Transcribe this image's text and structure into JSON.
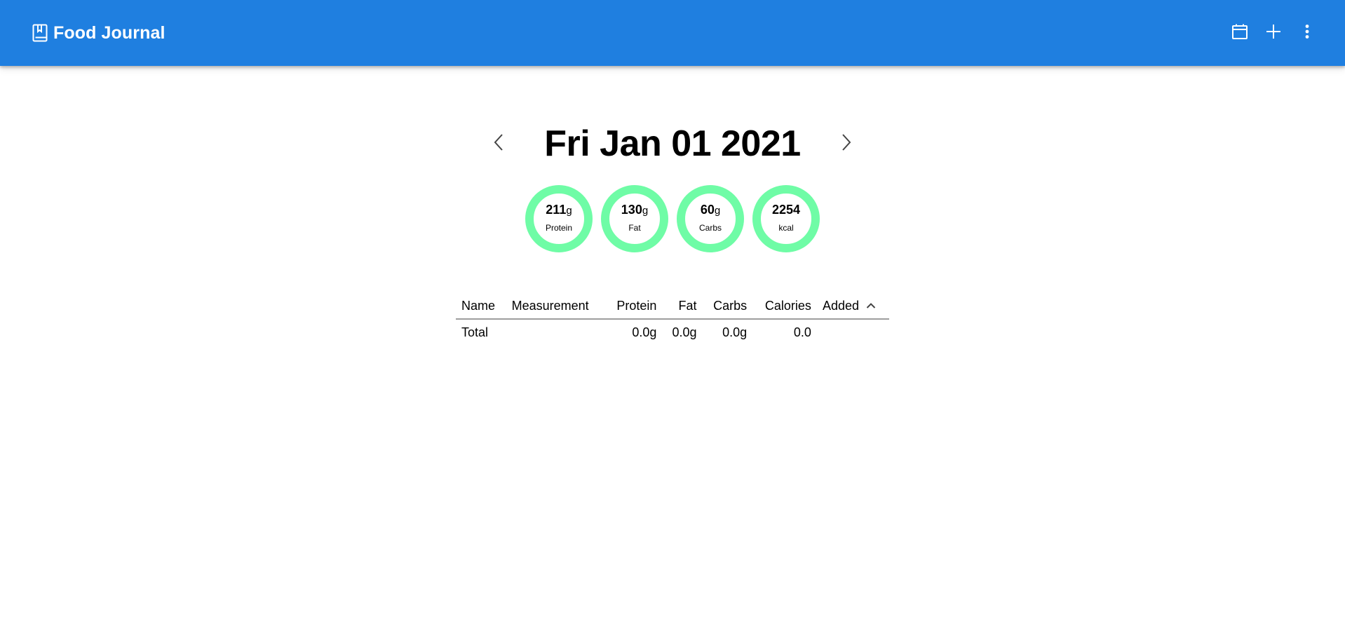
{
  "app": {
    "title": "Food Journal",
    "brand_icon": "book-bookmark-icon"
  },
  "toolbar": {
    "icons": [
      "calendar-icon",
      "plus-icon",
      "more-vertical-icon"
    ]
  },
  "date": {
    "title": "Fri Jan 01 2021"
  },
  "macros": [
    {
      "value": "211",
      "unit": "g",
      "label": "Protein"
    },
    {
      "value": "130",
      "unit": "g",
      "label": "Fat"
    },
    {
      "value": "60",
      "unit": "g",
      "label": "Carbs"
    },
    {
      "value": "2254",
      "unit": "",
      "label": "kcal"
    }
  ],
  "table": {
    "headers": [
      "Name",
      "Measurement",
      "Protein",
      "Fat",
      "Carbs",
      "Calories",
      "Added"
    ],
    "sort_column": "Added",
    "sort_direction": "ascending",
    "total": {
      "name": "Total",
      "measurement": "",
      "protein": "0.0g",
      "fat": "0.0g",
      "carbs": "0.0g",
      "calories": "0.0",
      "added": ""
    }
  },
  "colors": {
    "appbar": "#1f7fe0",
    "ring": "#6ffca6"
  }
}
